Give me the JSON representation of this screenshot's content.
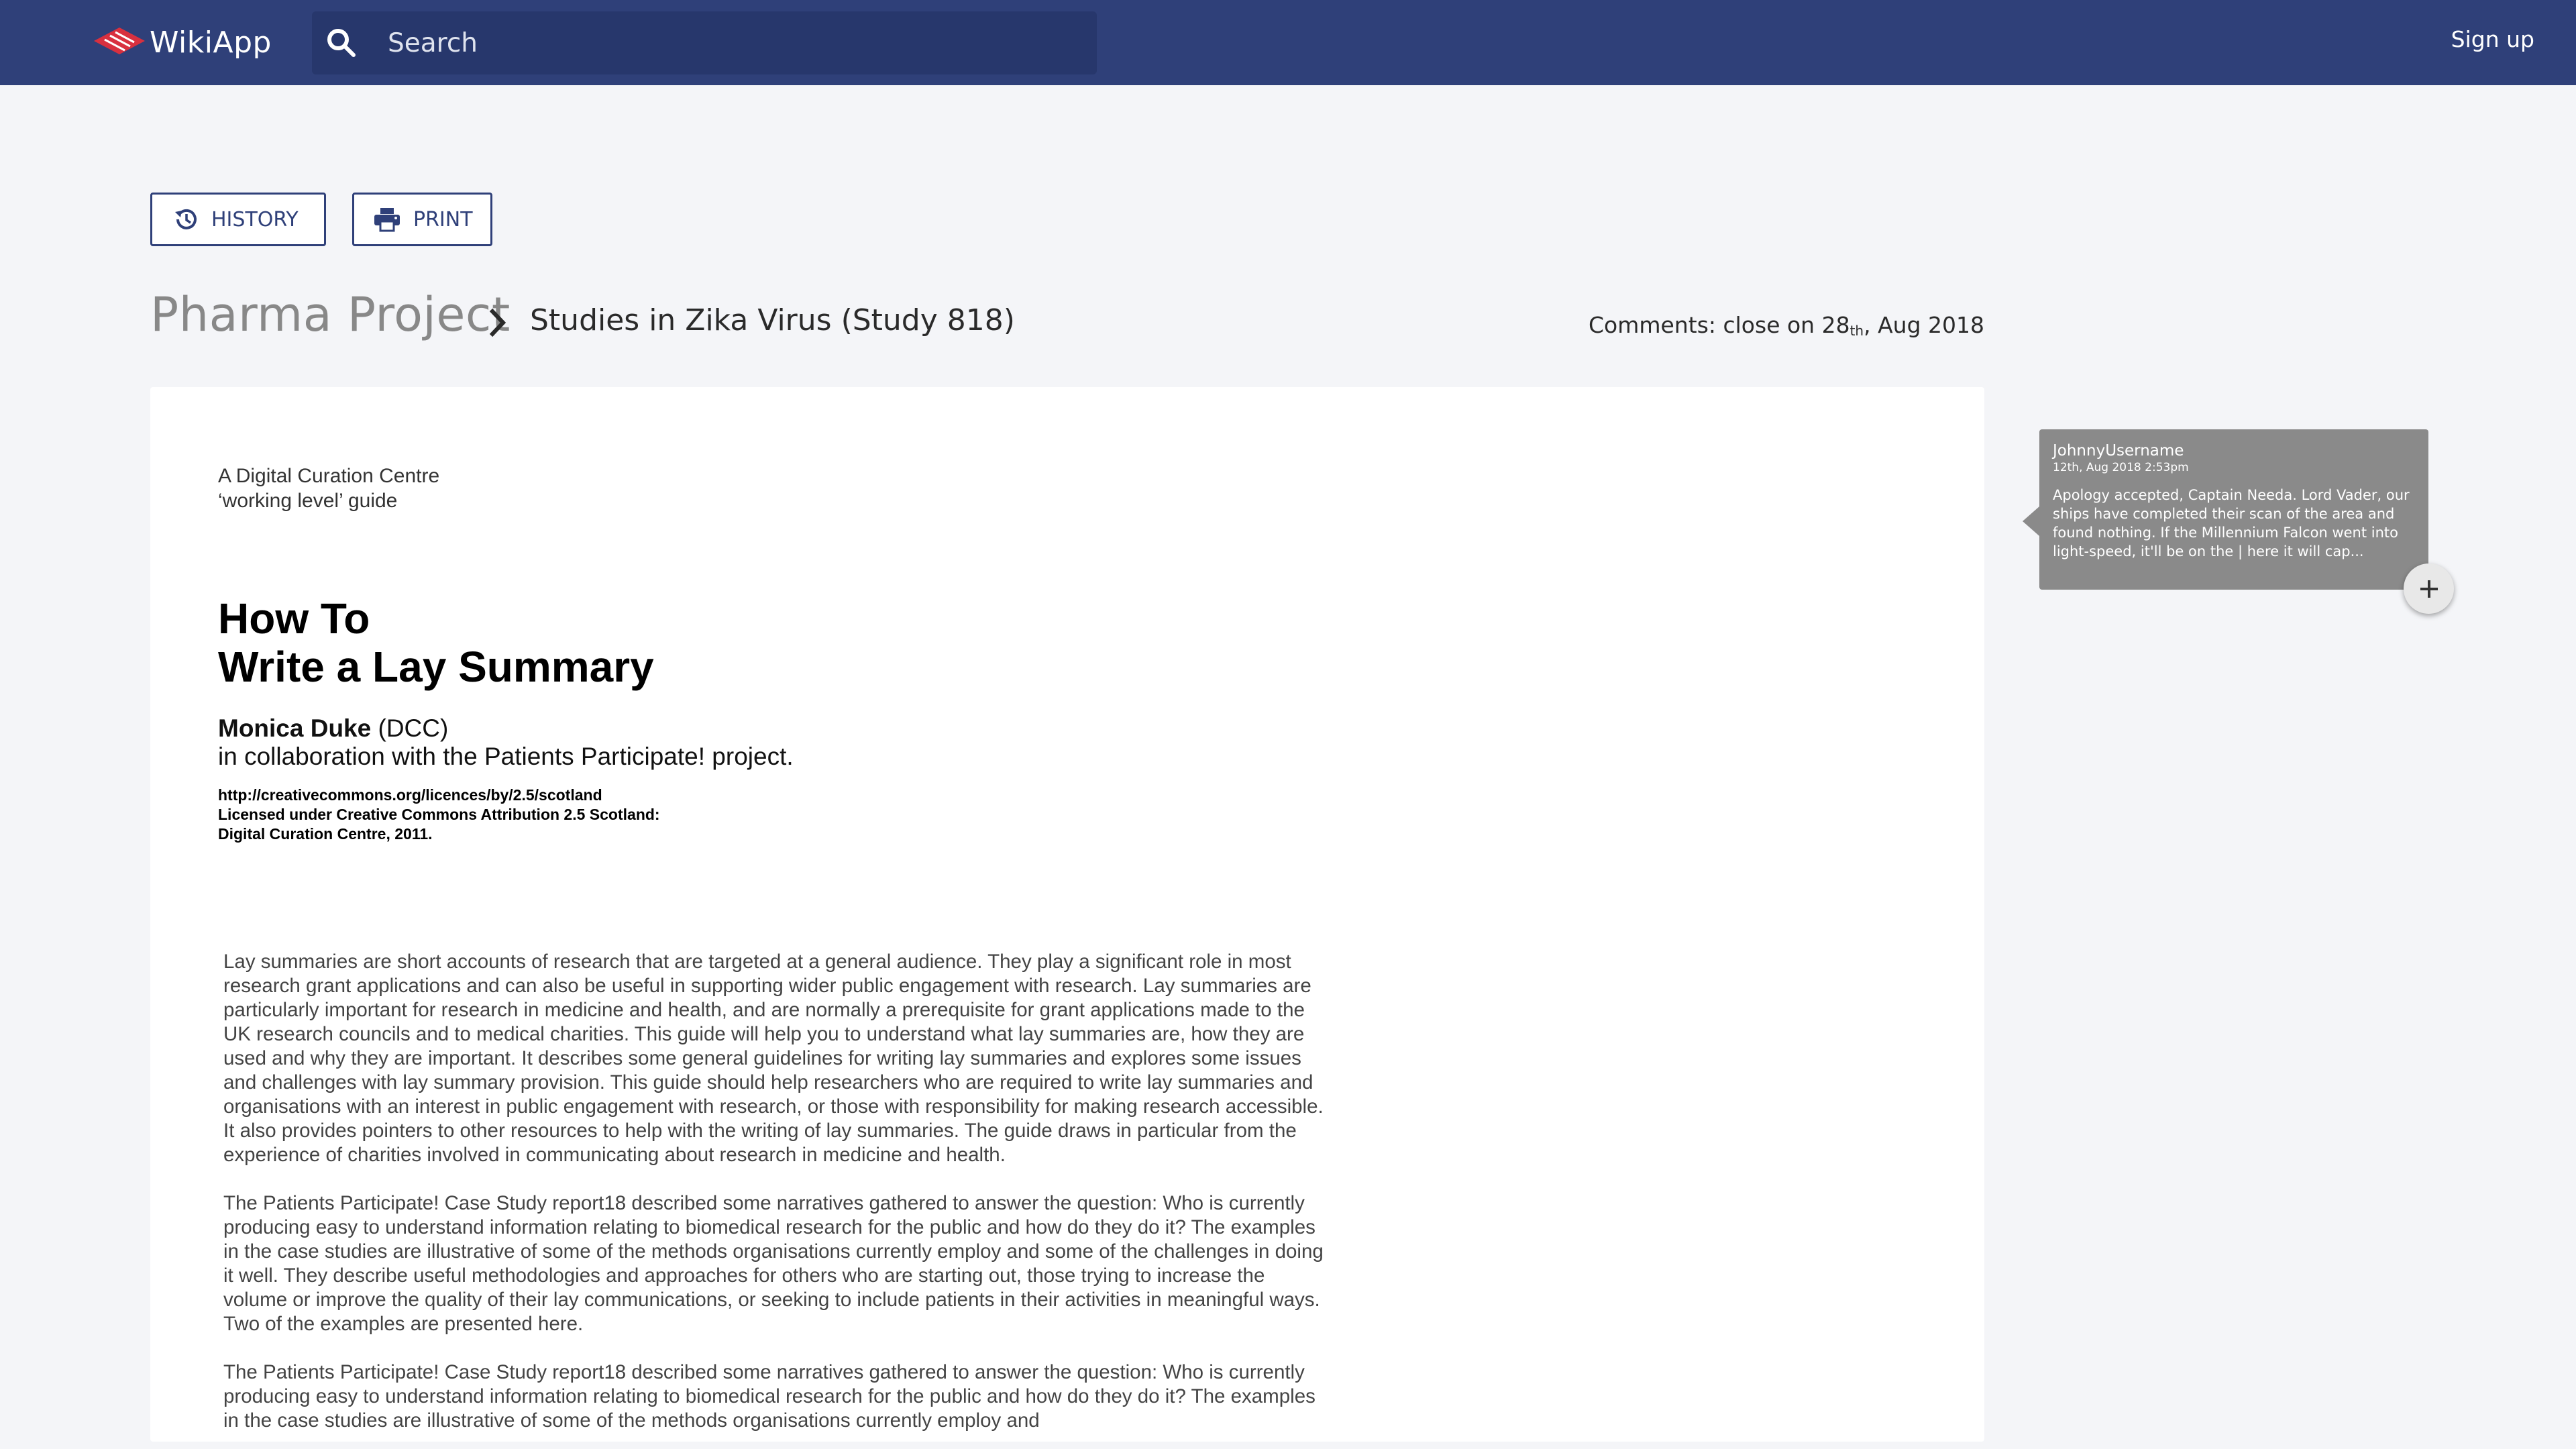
{
  "app": {
    "title": "WikiApp"
  },
  "header": {
    "search_placeholder": "Search",
    "signup_label": "Sign up"
  },
  "actions": {
    "history_label": "HISTORY",
    "print_label": "PRINT"
  },
  "breadcrumb": {
    "root": "Pharma Project",
    "current": "Studies in Zika Virus (Study 818)"
  },
  "comments_status": {
    "prefix": "Comments: close on 28",
    "ordinal": "th",
    "suffix": ", Aug 2018"
  },
  "document": {
    "guide_line_1": "A Digital Curation Centre",
    "guide_line_2": "‘working level’ guide",
    "title_line_1": "How To",
    "title_line_2": "Write a Lay Summary",
    "author_name": "Monica Duke",
    "author_org": " (DCC)",
    "collaboration": "in collaboration with the Patients Participate! project.",
    "license_url": "http://creativecommons.org/licences/by/2.5/scotland",
    "license_line": "Licensed under Creative Commons Attribution 2.5 Scotland:",
    "license_holder": "Digital Curation Centre, 2011.",
    "paragraphs": [
      "Lay summaries are short accounts of research that are targeted at a general audience. They play a significant role in most research grant applications and can also be useful in supporting wider public engagement with research. Lay summaries are particularly important for research in medicine and health, and are normally a prerequisite for grant applications made to the UK research councils and to medical charities. This guide will help you to understand what lay summaries are, how they are used and why they are important. It describes some general guidelines for writing lay summaries and explores some issues and challenges with lay summary provision. This guide should help researchers who are required to write lay summaries and organisations with an interest in public engagement with research, or those with responsibility for making research accessible. It also provides pointers to other resources to help with the writing of lay summaries. The guide draws in particular from the experience of charities involved in communicating about research in medicine and health.",
      "The Patients Participate! Case Study report18 described some narratives gathered to answer the question: Who is currently producing easy to understand information relating to biomedical research for the public and how do they do it? The examples in the case studies are illustrative of some of the methods organisations currently employ and some of the challenges in doing it well. They describe useful methodologies and approaches for others who are starting out, those trying to increase the volume or improve the quality of their lay communications, or seeking to include patients in their activities in meaningful ways. Two of the examples are presented here.",
      "The Patients Participate! Case Study report18 described some narratives gathered to answer the question: Who is currently producing easy to understand information relating to biomedical research for the public and how do they do it? The examples in the case studies are illustrative of some of the methods organisations currently employ and"
    ]
  },
  "comment": {
    "user": "JohnnyUsername",
    "date": "12th, Aug 2018 2:53pm",
    "text": "Apology accepted, Captain Needa. Lord Vader, our ships have completed their scan of the area and found nothing. If the Millennium Falcon went into light-speed, it'll be on the | here it will cap..."
  },
  "colors": {
    "header_bg": "#2f4079",
    "accent": "#2f4079",
    "logo_red": "#d8303f",
    "comment_bg": "#8a8a8a"
  },
  "icons": {
    "logo": "wikiapp-logo",
    "search": "search-icon",
    "history": "history-icon",
    "print": "printer-icon",
    "breadcrumb_sep": "chevron-right-icon",
    "add": "plus-icon"
  }
}
